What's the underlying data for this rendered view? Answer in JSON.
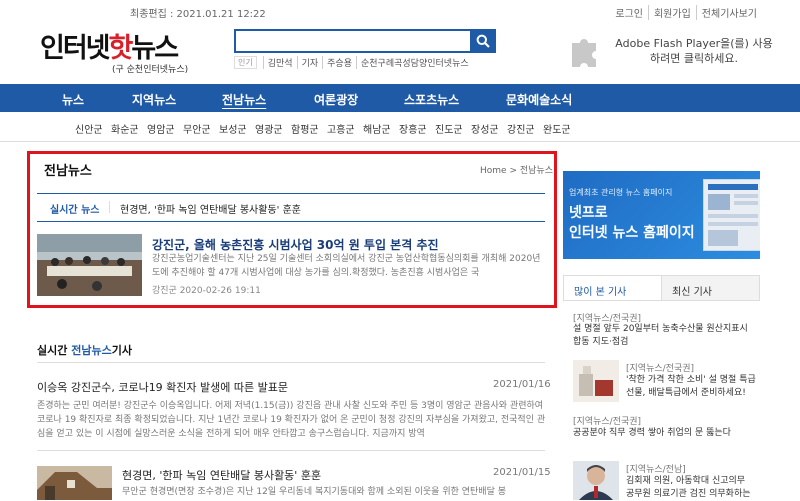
{
  "topbar": {
    "date": "최종편집 : 2021.01.21 12:22",
    "links": [
      "로그인",
      "회원가입",
      "전체기사보기"
    ]
  },
  "logo": {
    "text_a": "인터넷",
    "text_b": "핫",
    "text_c": "뉴스",
    "sub": "(구 순천인터넷뉴스)"
  },
  "search": {
    "value": "",
    "hot_tag": "인기",
    "hot_words": [
      "김만석",
      "기자",
      "주승용",
      "순천구례곡성담양인터넷뉴스"
    ]
  },
  "flash": {
    "text_line1": "Adobe Flash Player을(를) 사용",
    "text_line2": "하려면 클릭하세요."
  },
  "nav": {
    "items": [
      "뉴스",
      "지역뉴스",
      "전남뉴스",
      "여론광장",
      "스포츠뉴스",
      "문화예술소식"
    ],
    "active": "전남뉴스"
  },
  "subnav": {
    "items": [
      "신안군",
      "화순군",
      "영암군",
      "무안군",
      "보성군",
      "영광군",
      "함평군",
      "고흥군",
      "해남군",
      "장흥군",
      "진도군",
      "장성군",
      "강진군",
      "완도군"
    ]
  },
  "section": {
    "title": "전남뉴스",
    "breadcrumb_home": "Home",
    "breadcrumb_sep": ">",
    "breadcrumb_current": "전남뉴스",
    "realtime_label": "실시간 뉴스",
    "realtime_text": "현경면, '한파 녹임 연탄배달 봉사활동' 훈훈"
  },
  "featured": {
    "title": "강진군, 올해 농촌진흥 시범사업 30억 원 투입 본격 추진",
    "body": "강진군농업기술센터는 지난 25일 기술센터 소회의실에서 강진군 농업산학협동심의회를 개최해 2020년도에 추진해야 할 47개 시범사업에 대상 농가를 심의.확정했다. 농촌진흥 시범사업은 국",
    "meta": "강진군 2020-02-26 19:11"
  },
  "realtime_list": {
    "prefix": "실시간",
    "highlight": "전남뉴스",
    "suffix": "기사",
    "articles": [
      {
        "title": "이승옥 강진군수, 코로나19 확진자 발생에 따른 발표문",
        "date": "2021/01/16",
        "body": "존경하는 군민 여러분! 강진군수 이승옥입니다. 어제 저녁(1.15(금)) 강진읍 관내 사찰 신도와 주민 등 3명이 영암군 관음사와 관련하여 코로나 19 확진자로 최종 확정되었습니다. 지난 1년간 코로나 19 확진자가 없어 온 군민이 청정 강진의 자부심을 가져왔고, 전국적인 관심을 얻고 있는 이 시점에 실망스러운 소식을 전하게 되어 매우 안타깝고 송구스럽습니다. 지금까지 방역"
      },
      {
        "title": "현경면, '한파 녹임 연탄배달 봉사활동' 훈훈",
        "date": "2021/01/15",
        "body": "무안군 현경면(면장 조수경)은 지난 12일 우리동네 복지기동대와 함께 소외된 이웃을 위한 연탄배달 봉"
      }
    ]
  },
  "ad": {
    "small": "업계최초 관리형 뉴스 홈페이지",
    "big_line1": "넷프로",
    "big_line2": "인터넷 뉴스 홈페이지"
  },
  "sidebar": {
    "tabs": [
      "많이 본 기사",
      "최신 기사"
    ],
    "items": [
      {
        "cat": "[지역뉴스/전국권]",
        "text1": "설 명절 앞두 20일부터 농축수산물 원산지표시",
        "text2": "합동 지도·점검"
      },
      {
        "cat": "[지역뉴스/전국권]",
        "text1": "'착한 가격 착한 소비' 설 명절 특급",
        "text2": "선물, 배달특급에서 준비하세요!"
      },
      {
        "cat": "[지역뉴스/전국권]",
        "text1": "공공분야 직무 경력 쌓아 취업의 문 뚫는다",
        "text2": ""
      },
      {
        "cat": "[지역뉴스/전남]",
        "text1": "김회재 의원, 아동학대 신고의무",
        "text2": "공무원 의료기관 검진 의무화하는"
      }
    ]
  }
}
